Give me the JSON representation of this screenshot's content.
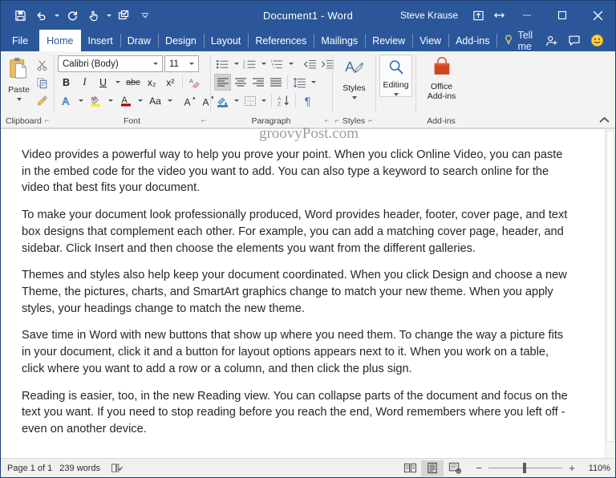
{
  "window": {
    "title": "Document1  -  Word",
    "account_name": "Steve Krause",
    "quick_access": [
      {
        "name": "save",
        "label": "Save"
      },
      {
        "name": "undo",
        "label": "Undo"
      },
      {
        "name": "redo",
        "label": "Redo"
      },
      {
        "name": "touch-mode",
        "label": "Touch/Mouse Mode"
      },
      {
        "name": "customize-qat",
        "label": "Customize Quick Access Toolbar"
      }
    ],
    "controls": {
      "ribbon_display_options": "Ribbon Display Options",
      "restore_down_hint": "Restore Down",
      "minimize": "Minimize",
      "maximize": "Maximize",
      "close": "Close"
    }
  },
  "ribbon": {
    "tabs": [
      {
        "label": "File",
        "active": false
      },
      {
        "label": "Home",
        "active": true
      },
      {
        "label": "Insert",
        "active": false
      },
      {
        "label": "Draw",
        "active": false
      },
      {
        "label": "Design",
        "active": false
      },
      {
        "label": "Layout",
        "active": false
      },
      {
        "label": "References",
        "active": false
      },
      {
        "label": "Mailings",
        "active": false
      },
      {
        "label": "Review",
        "active": false
      },
      {
        "label": "View",
        "active": false
      },
      {
        "label": "Add-ins",
        "active": false
      }
    ],
    "tell_me": "Tell me",
    "share_icon": "share-person-icon",
    "comments_icon": "comments-icon",
    "feedback_icon": "smiley-feedback-icon",
    "collapse_label": "Collapse the Ribbon",
    "groups": {
      "clipboard": {
        "label": "Clipboard",
        "paste": "Paste",
        "cut": "Cut",
        "copy": "Copy",
        "format_painter": "Format Painter",
        "dialog_launcher": "Clipboard settings"
      },
      "font": {
        "label": "Font",
        "font_name": "Calibri (Body)",
        "font_size": "11",
        "bold": "B",
        "italic": "I",
        "underline": "U",
        "strikethrough": "abc",
        "subscript": "x₂",
        "superscript": "x²",
        "clear_formatting": "Clear All Formatting",
        "text_effects": "A",
        "highlight": "Text Highlight Color",
        "font_color": "A",
        "change_case": "Aa",
        "grow_font": "A",
        "shrink_font": "A",
        "dialog_launcher": "Font settings"
      },
      "paragraph": {
        "label": "Paragraph",
        "bullets": "Bullets",
        "numbering": "Numbering",
        "multilevel": "Multilevel List",
        "decrease_indent": "Decrease Indent",
        "increase_indent": "Increase Indent",
        "align_left": "Align Left",
        "align_center": "Center",
        "align_right": "Align Right",
        "justify": "Justify",
        "line_spacing": "Line and Paragraph Spacing",
        "shading": "Shading",
        "borders": "Borders",
        "sort": "Sort",
        "show_marks": "¶",
        "dialog_launcher": "Paragraph settings"
      },
      "styles": {
        "label": "Styles",
        "button": "Styles",
        "dialog_launcher": "Styles pane"
      },
      "editing": {
        "label": "",
        "button": "Editing"
      },
      "addins": {
        "label": "Add-ins",
        "button_line1": "Office",
        "button_line2": "Add-ins"
      }
    }
  },
  "watermark": "groovyPost.com",
  "document": {
    "paragraphs": [
      "Video provides a powerful way to help you prove your point. When you click Online Video, you can paste in the embed code for the video you want to add. You can also type a keyword to search online for the video that best fits your document.",
      "To make your document look professionally produced, Word provides header, footer, cover page, and text box designs that complement each other. For example, you can add a matching cover page, header, and sidebar. Click Insert and then choose the elements you want from the different galleries.",
      "Themes and styles also help keep your document coordinated. When you click Design and choose a new Theme, the pictures, charts, and SmartArt graphics change to match your new theme. When you apply styles, your headings change to match the new theme.",
      "Save time in Word with new buttons that show up where you need them. To change the way a picture fits in your document, click it and a button for layout options appears next to it. When you work on a table, click where you want to add a row or a column, and then click the plus sign.",
      "Reading is easier, too, in the new Reading view. You can collapse parts of the document and focus on the text you want. If you need to stop reading before you reach the end, Word remembers where you left off - even on another device."
    ]
  },
  "status": {
    "page": "Page 1 of 1",
    "words": "239 words",
    "proofing_icon": "proofing-errors-icon",
    "views": [
      {
        "name": "read-mode",
        "label": "Read Mode",
        "selected": false
      },
      {
        "name": "print-layout",
        "label": "Print Layout",
        "selected": true
      },
      {
        "name": "web-layout",
        "label": "Web Layout",
        "selected": false
      }
    ],
    "zoom_out": "−",
    "zoom_in": "+",
    "zoom_level": "110%"
  },
  "colors": {
    "word_blue": "#2b579a",
    "ribbon_bg": "#f3f3f3",
    "accent_orange": "#d04423",
    "text": "#262626"
  }
}
